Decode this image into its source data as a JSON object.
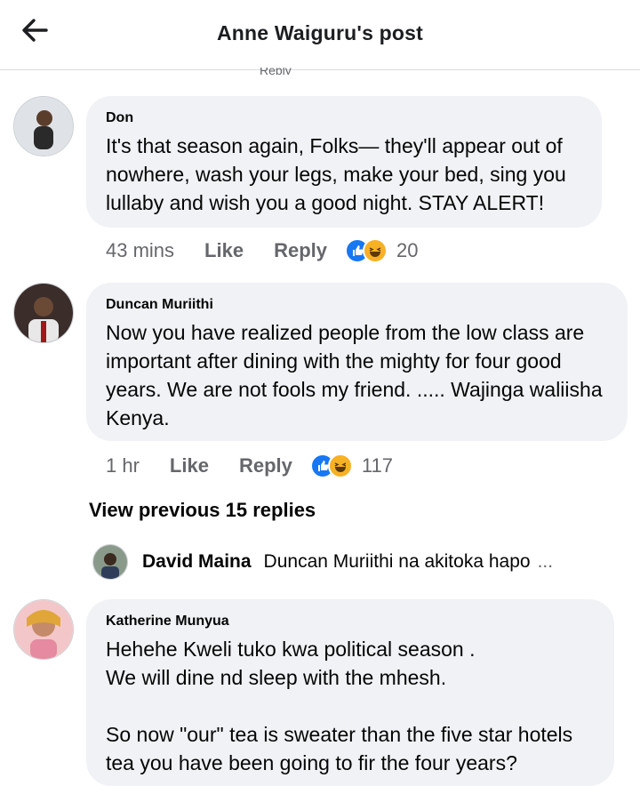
{
  "header": {
    "title": "Anne Waiguru's post",
    "back_icon": "arrow-left-icon"
  },
  "cutoff_text": "Reply",
  "comments": [
    {
      "name": "Don",
      "text": "It's that season again, Folks— they'll appear out of nowhere, wash your legs, make your bed, sing you lullaby and wish you a good night. STAY ALERT!",
      "time": "43 mins",
      "like": "Like",
      "reply": "Reply",
      "reaction_count": "20"
    },
    {
      "name": "Duncan Muriithi",
      "text": "Now you have realized people from the low class are important after dining with the mighty for four good years. We are not fools my friend. ..... Wajinga waliisha Kenya.",
      "time": "1 hr",
      "like": "Like",
      "reply": "Reply",
      "reaction_count": "117"
    }
  ],
  "view_previous": "View previous 15 replies",
  "reply_preview": {
    "name": "David Maina",
    "text": "Duncan Muriithi na akitoka hapo",
    "more": "..."
  },
  "comment3": {
    "name": "Katherine Munyua",
    "text": "Hehehe Kweli tuko kwa  political season .\nWe will dine nd sleep with the mhesh.\n\nSo now \"our\" tea is sweater than the five star hotels tea you have been going to fir the four years?"
  },
  "colors": {
    "like_blue": "#1877f2",
    "haha_yellow": "#f7b125",
    "bubble": "#f0f2f5",
    "meta": "#65676b"
  }
}
